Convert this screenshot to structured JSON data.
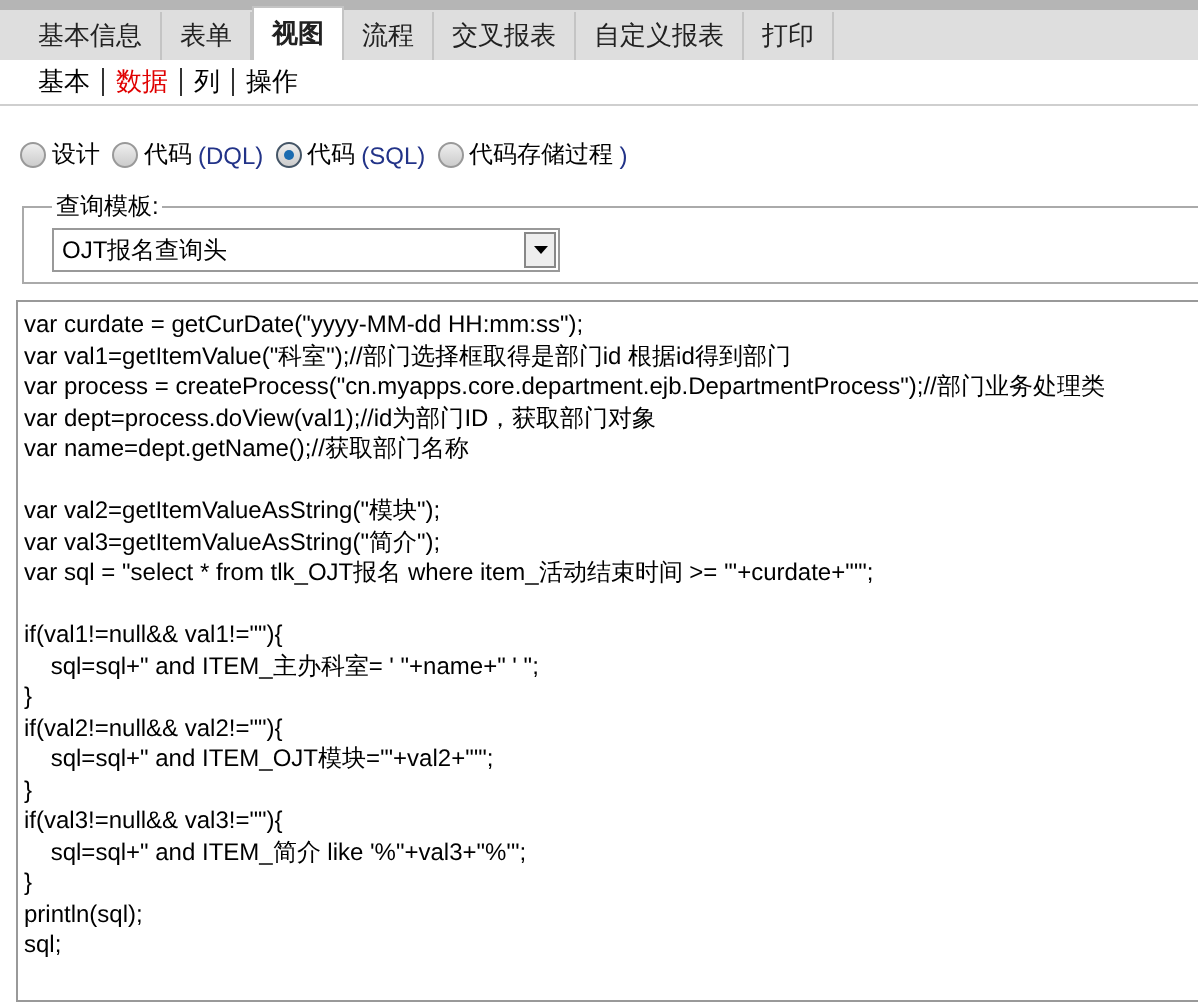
{
  "tabs": [
    {
      "label": "基本信息",
      "selected": false
    },
    {
      "label": "表单",
      "selected": false
    },
    {
      "label": "视图",
      "selected": true
    },
    {
      "label": "流程",
      "selected": false
    },
    {
      "label": "交叉报表",
      "selected": false
    },
    {
      "label": "自定义报表",
      "selected": false
    },
    {
      "label": "打印",
      "selected": false
    }
  ],
  "subtabs": [
    {
      "label": "基本",
      "selected": false
    },
    {
      "label": "数据",
      "selected": true
    },
    {
      "label": "列",
      "selected": false
    },
    {
      "label": "操作",
      "selected": false
    }
  ],
  "modes": [
    {
      "label": "设计",
      "selected": false
    },
    {
      "label": "代码",
      "suffix": "(DQL)",
      "selected": false
    },
    {
      "label": "代码",
      "suffix": "(SQL)",
      "selected": true
    },
    {
      "label": "代码存储过程",
      "suffix": ")",
      "selected": false
    }
  ],
  "query_template": {
    "legend": "查询模板:",
    "value": "OJT报名查询头"
  },
  "code_blocks": [
    [
      "var curdate = getCurDate(\"yyyy-MM-dd HH:mm:ss\");",
      "var val1=getItemValue(\"科室\");//部门选择框取得是部门id 根据id得到部门",
      "var process = createProcess(\"cn.myapps.core.department.ejb.DepartmentProcess\");//部门业务处理类",
      "var dept=process.doView(val1);//id为部门ID，获取部门对象",
      "var name=dept.getName();//获取部门名称"
    ],
    [
      "var val2=getItemValueAsString(\"模块\");",
      "var val3=getItemValueAsString(\"简介\");",
      "var sql = \"select * from tlk_OJT报名 where item_活动结束时间 >= '\"+curdate+\"'\";"
    ],
    [
      "if(val1!=null&& val1!=\"\"){",
      "\tsql=sql+\" and ITEM_主办科室= ' \"+name+\" ' \";",
      "}",
      "if(val2!=null&& val2!=\"\"){",
      "\tsql=sql+\" and ITEM_OJT模块='\"+val2+\"'\";",
      "}",
      "if(val3!=null&& val3!=\"\"){",
      "\tsql=sql+\" and ITEM_简介 like '%\"+val3+\"%'\";",
      "}",
      "println(sql);",
      "sql;"
    ]
  ]
}
